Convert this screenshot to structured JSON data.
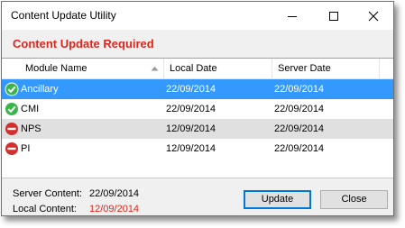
{
  "window": {
    "title": "Content Update Utility"
  },
  "heading": "Content Update Required",
  "list": {
    "columns": [
      "Module Name",
      "Local Date",
      "Server Date"
    ],
    "rows": [
      {
        "name": "Ancillary",
        "local": "22/09/2014",
        "server": "22/09/2014",
        "status": "ok",
        "selected": true
      },
      {
        "name": "CMI",
        "local": "22/09/2014",
        "server": "22/09/2014",
        "status": "ok",
        "selected": false
      },
      {
        "name": "NPS",
        "local": "12/09/2014",
        "server": "22/09/2014",
        "status": "outdated",
        "selected": false
      },
      {
        "name": "PI",
        "local": "12/09/2014",
        "server": "22/09/2014",
        "status": "outdated",
        "selected": false
      }
    ]
  },
  "footer": {
    "server_label": "Server Content:",
    "server_value": "22/09/2014",
    "local_label": "Local Content:",
    "local_value": "12/09/2014"
  },
  "buttons": {
    "update_label": "Update",
    "close_label": "Close"
  },
  "colors": {
    "accent_red": "#e0251b",
    "selection_blue": "#3399ff",
    "ok_green": "#3ab54a",
    "error_red": "#d32f2f"
  },
  "icons": {
    "ok": "check-circle-icon",
    "outdated": "no-entry-icon"
  }
}
